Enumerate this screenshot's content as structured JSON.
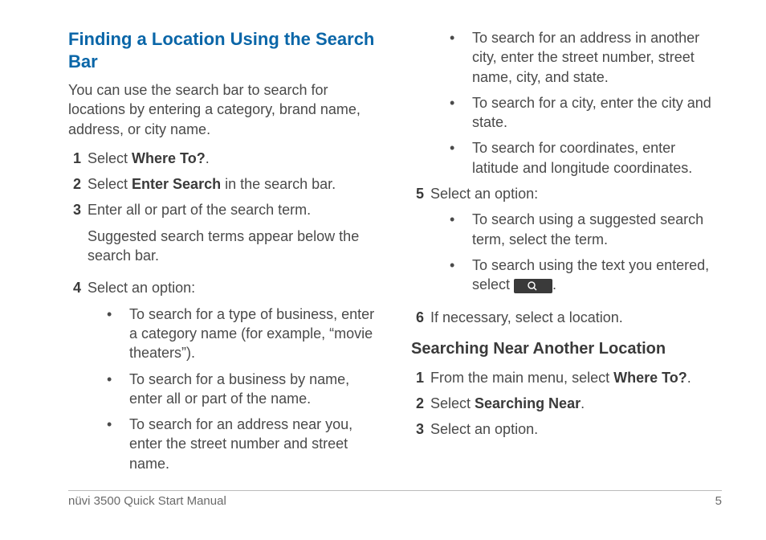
{
  "heading": "Finding a Location Using the Search Bar",
  "intro": "You can use the search bar to search for locations by entering a category, brand name, address, or city name.",
  "steps": {
    "s1_pre": "Select ",
    "s1_bold": "Where To?",
    "s1_post": ".",
    "s2_pre": "Select ",
    "s2_bold": "Enter Search",
    "s2_post": " in the search bar.",
    "s3a": "Enter all or part of the search term.",
    "s3b": "Suggested search terms appear below the search bar.",
    "s4": "Select an option:",
    "s4_b1": "To search for a type of business, enter a category name (for example, “movie theaters”).",
    "s4_b2": "To search for a business by name, enter all or part of the name.",
    "s4_b3": "To search for an address near you, enter the street number and street name.",
    "s4_b4": "To search for an address in another city, enter the street number, street name, city, and state.",
    "s4_b5": "To search for a city, enter the city and state.",
    "s4_b6": "To search for coordinates, enter latitude and longitude coordinates.",
    "s5": "Select an option:",
    "s5_b1": "To search using a suggested search term, select the term.",
    "s5_b2_pre": "To search using the text you entered, select ",
    "s5_b2_post": ".",
    "s6": "If necessary, select a location."
  },
  "subheading": "Searching Near Another Location",
  "near": {
    "n1_pre": "From the main menu, select ",
    "n1_bold": "Where To?",
    "n1_post": ".",
    "n2_pre": "Select ",
    "n2_bold": "Searching Near",
    "n2_post": ".",
    "n3": "Select an option."
  },
  "footer_left": "nüvi 3500 Quick Start Manual",
  "footer_right": "5"
}
